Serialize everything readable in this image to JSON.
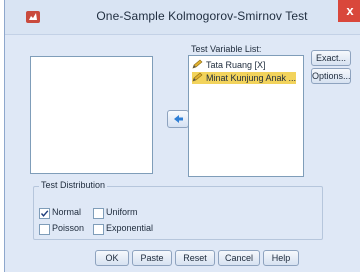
{
  "dialog": {
    "title": "One-Sample Kolmogorov-Smirnov Test",
    "close_glyph": "x"
  },
  "test_variable_list": {
    "label": "Test Variable List:",
    "items": [
      {
        "label": "Tata Ruang [X]",
        "icon": "pencil-icon",
        "selected": false
      },
      {
        "label": "Minat Kunjung Anak ...",
        "icon": "pencil-icon",
        "selected": true
      }
    ]
  },
  "side_buttons": {
    "exact": "Exact...",
    "options": "Options..."
  },
  "test_distribution": {
    "title": "Test Distribution",
    "options": [
      {
        "label": "Normal",
        "checked": true
      },
      {
        "label": "Uniform",
        "checked": false
      },
      {
        "label": "Poisson",
        "checked": false
      },
      {
        "label": "Exponential",
        "checked": false
      }
    ]
  },
  "footer_buttons": {
    "ok": "OK",
    "paste": "Paste",
    "reset": "Reset",
    "cancel": "Cancel",
    "help": "Help"
  },
  "colors": {
    "selection": "#f2d35c",
    "close": "#d9473b",
    "arrow": "#2f7fd6"
  }
}
